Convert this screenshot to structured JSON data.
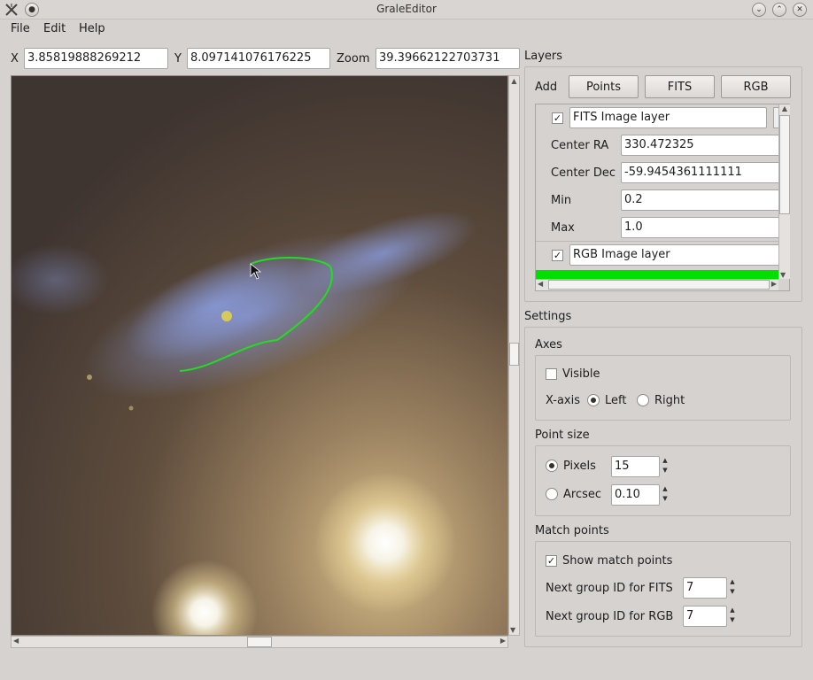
{
  "window": {
    "title": "GraleEditor"
  },
  "menu": [
    "File",
    "Edit",
    "Help"
  ],
  "coords": {
    "x_label": "X",
    "x_value": "3.85819888269212",
    "y_label": "Y",
    "y_value": "8.097141076176225",
    "zoom_label": "Zoom",
    "zoom_value": "39.39662122703731"
  },
  "layers": {
    "title": "Layers",
    "add_label": "Add",
    "add_buttons": [
      "Points",
      "FITS",
      "RGB"
    ],
    "fits_layer": {
      "name": "FITS Image layer",
      "checked": true,
      "center_ra_label": "Center RA",
      "center_ra": "330.472325",
      "center_dec_label": "Center Dec",
      "center_dec": "-59.9454361111111",
      "min_label": "Min",
      "min": "0.2",
      "max_label": "Max",
      "max": "1.0"
    },
    "rgb_layer": {
      "name": "RGB Image layer",
      "checked": true
    },
    "highlight_color": "#00e000"
  },
  "settings": {
    "title": "Settings",
    "axes": {
      "title": "Axes",
      "visible_label": "Visible",
      "visible": false,
      "xaxis_label": "X-axis",
      "left_label": "Left",
      "right_label": "Right",
      "selected": "Left"
    },
    "point_size": {
      "title": "Point size",
      "pixels_label": "Pixels",
      "pixels_value": "15",
      "arcsec_label": "Arcsec",
      "arcsec_value": "0.10",
      "selected": "Pixels"
    },
    "match_points": {
      "title": "Match points",
      "show_label": "Show match points",
      "show": true,
      "fits_id_label": "Next group ID for FITS",
      "fits_id": "7",
      "rgb_id_label": "Next group ID for RGB",
      "rgb_id": "7"
    }
  },
  "colors": {
    "contour": "#22dd22"
  }
}
